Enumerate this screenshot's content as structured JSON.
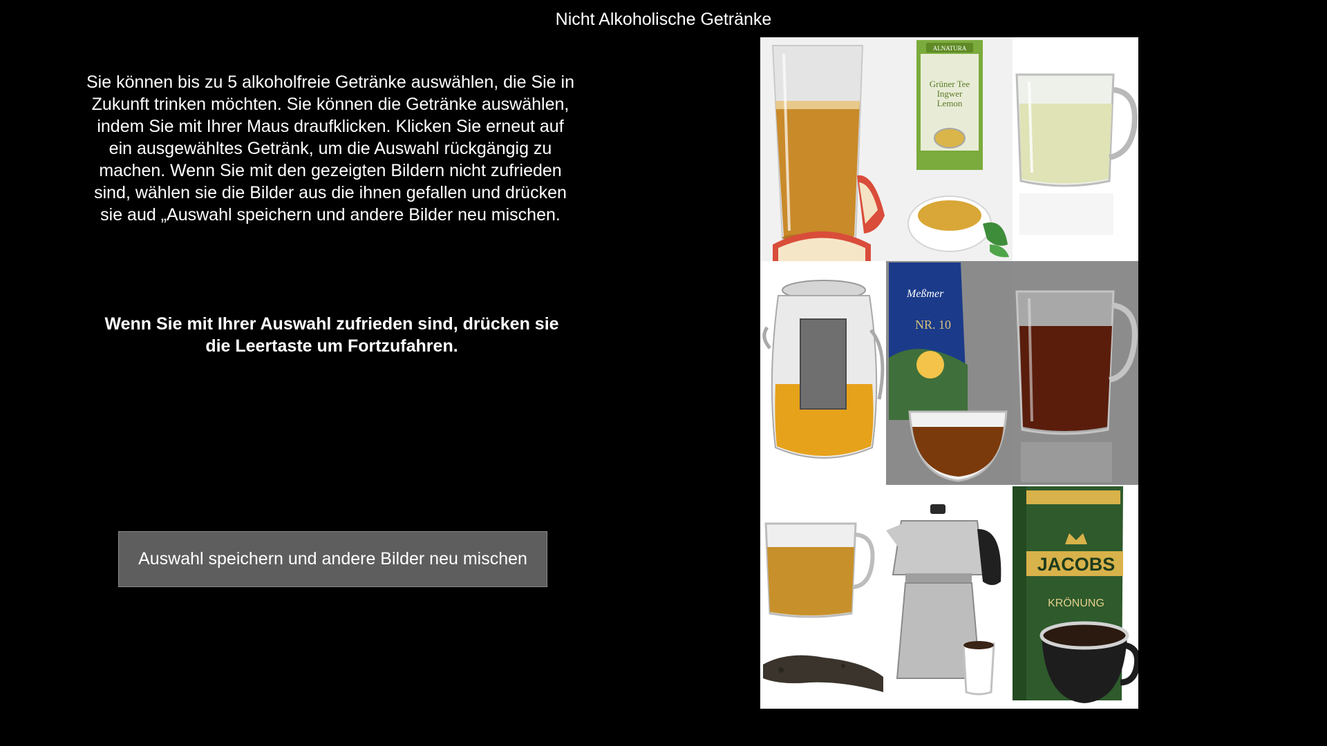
{
  "page": {
    "title": "Nicht Alkoholische Getränke",
    "instructions": "Sie können bis zu 5 alkoholfreie Getränke auswählen, die Sie in\nZukunft trinken möchten. Sie können die Getränke auswählen,\nindem Sie mit Ihrer Maus draufklicken. Klicken Sie erneut auf\nein ausgewähltes Getränk, um die Auswahl rückgängig zu\nmachen. Wenn Sie mit den gezeigten Bildern nicht zufrieden\nsind, wählen sie die Bilder aus die ihnen gefallen und drücken\nsie aud „Auswahl speichern und andere Bilder neu mischen.",
    "continue_prompt": "Wenn Sie mit Ihrer Auswahl zufrieden sind, drücken sie\ndie Leertaste um Fortzufahren.",
    "shuffle_button_label": "Auswahl speichern und andere Bilder neu mischen"
  },
  "max_selection": 5,
  "drink_images": [
    {
      "id": "apple-juice-glass",
      "icon": "juice-glass-icon"
    },
    {
      "id": "alnatura-green-tea-box",
      "icon": "tea-box-icon",
      "package_text": [
        "ALNATURA",
        "Grüner Tee",
        "Ingwer",
        "Lemon"
      ]
    },
    {
      "id": "green-tea-glass-mug",
      "icon": "glass-mug-icon"
    },
    {
      "id": "glass-teapot-infuser",
      "icon": "teapot-icon"
    },
    {
      "id": "messmer-tea-box",
      "icon": "tea-box-icon",
      "package_text": [
        "Meßmer",
        "NR. 10"
      ]
    },
    {
      "id": "black-tea-glass-mug",
      "icon": "glass-mug-icon"
    },
    {
      "id": "black-tea-glass-cup-leaves",
      "icon": "glass-mug-icon"
    },
    {
      "id": "espresso-moka-pot",
      "icon": "moka-pot-icon"
    },
    {
      "id": "jacobs-kroenung-coffee",
      "icon": "coffee-pack-icon",
      "package_text": [
        "JACOBS",
        "KRÖNUNG",
        "JACOBS"
      ]
    }
  ],
  "colors": {
    "background": "#000000",
    "text": "#ffffff",
    "button_background": "#5e5e5e",
    "tile_light": "#f2f2f2",
    "tile_grey": "#8c8c8c"
  }
}
